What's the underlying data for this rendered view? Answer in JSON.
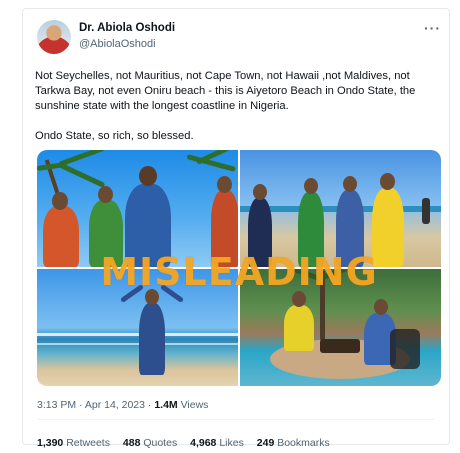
{
  "author": {
    "name": "Dr. Abiola Oshodi",
    "handle": "@AbiolaOshodi"
  },
  "more_icon": "more-horizontal-icon",
  "tweet": {
    "paragraph1": "Not Seychelles, not Mauritius, not Cape Town, not Hawaii ,not Maldives, not Tarkwa Bay, not even Oniru beach - this is Aiyetoro Beach in Ondo State, the sunshine state with the longest coastline in Nigeria.",
    "paragraph2": "Ondo State, so rich, so blessed."
  },
  "media": {
    "stamp_text": "MISLEADING"
  },
  "meta": {
    "time_date": "3:13 PM · Apr 14, 2023 · ",
    "views_count": "1.4M",
    "views_label": " Views"
  },
  "stats": {
    "retweets_count": "1,390",
    "retweets_label": " Retweets",
    "quotes_count": "488",
    "quotes_label": " Quotes",
    "likes_count": "4,968",
    "likes_label": " Likes",
    "bookmarks_count": "249",
    "bookmarks_label": " Bookmarks"
  }
}
